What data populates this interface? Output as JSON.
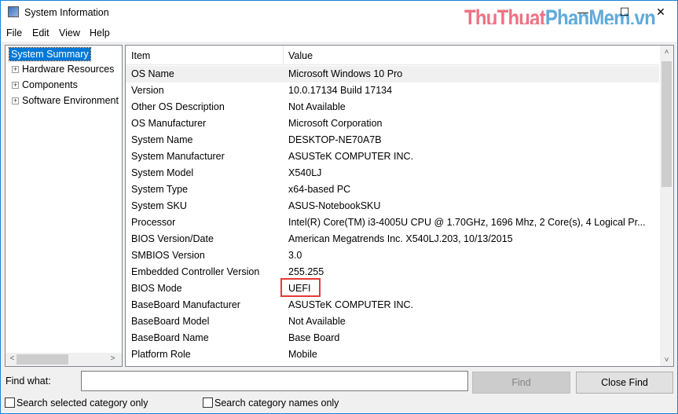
{
  "window": {
    "title": "System Information",
    "watermark_a": "ThuThuat",
    "watermark_b": "PhanMem.vn",
    "minimize": "—",
    "maximize": "☐",
    "close": "✕"
  },
  "menu": [
    "File",
    "Edit",
    "View",
    "Help"
  ],
  "tree": {
    "selected": "System Summary",
    "items": [
      "Hardware Resources",
      "Components",
      "Software Environment"
    ]
  },
  "table": {
    "headers": [
      "Item",
      "Value"
    ],
    "rows": [
      [
        "OS Name",
        "Microsoft Windows 10 Pro"
      ],
      [
        "Version",
        "10.0.17134 Build 17134"
      ],
      [
        "Other OS Description",
        "Not Available"
      ],
      [
        "OS Manufacturer",
        "Microsoft Corporation"
      ],
      [
        "System Name",
        "DESKTOP-NE70A7B"
      ],
      [
        "System Manufacturer",
        "ASUSTeK COMPUTER INC."
      ],
      [
        "System Model",
        "X540LJ"
      ],
      [
        "System Type",
        "x64-based PC"
      ],
      [
        "System SKU",
        "ASUS-NotebookSKU"
      ],
      [
        "Processor",
        "Intel(R) Core(TM) i3-4005U CPU @ 1.70GHz, 1696 Mhz, 2 Core(s), 4 Logical Pr..."
      ],
      [
        "BIOS Version/Date",
        "American Megatrends Inc. X540LJ.203, 10/13/2015"
      ],
      [
        "SMBIOS Version",
        "3.0"
      ],
      [
        "Embedded Controller Version",
        "255.255"
      ],
      [
        "BIOS Mode",
        "UEFI"
      ],
      [
        "BaseBoard Manufacturer",
        "ASUSTeK COMPUTER INC."
      ],
      [
        "BaseBoard Model",
        "Not Available"
      ],
      [
        "BaseBoard Name",
        "Base Board"
      ],
      [
        "Platform Role",
        "Mobile"
      ]
    ]
  },
  "find": {
    "label": "Find what:",
    "value": "",
    "find_button": "Find",
    "close_button": "Close Find",
    "check1": "Search selected category only",
    "check2": "Search category names only"
  }
}
